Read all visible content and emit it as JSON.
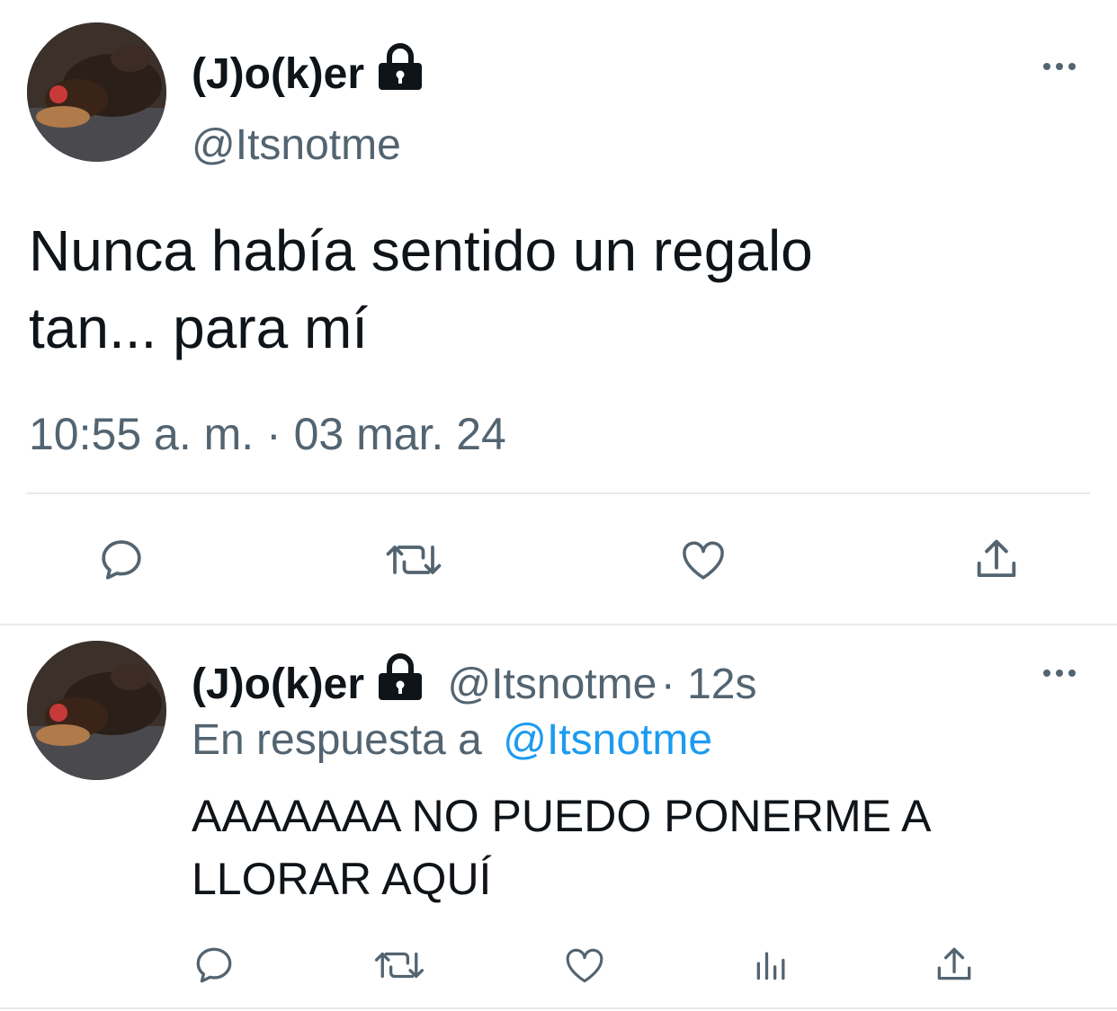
{
  "main_tweet": {
    "display_name": "(J)o(k)er",
    "handle": "@Itsnotme",
    "text_line1": "Nunca había sentido un regalo",
    "text_line2": "tan... para mí",
    "timestamp": "10:55 a. m. · 03 mar. 24",
    "avatar": "dog-avatar",
    "actions": [
      "reply-icon",
      "retweet-icon",
      "like-icon",
      "share-icon"
    ]
  },
  "reply_tweet": {
    "display_name": "(J)o(k)er",
    "handle": "@Itsnotme",
    "time_ago": "· 12s",
    "in_reply_prefix": "En respuesta a",
    "in_reply_handle": "@Itsnotme",
    "text_line1": "AAAAAAA NO PUEDO PONERME A",
    "text_line2": "LLORAR AQUÍ",
    "avatar": "dog-avatar",
    "actions": [
      "reply-icon",
      "retweet-icon",
      "like-icon",
      "analytics-icon",
      "share-icon"
    ]
  },
  "colors": {
    "text": "#0f1419",
    "secondary": "#536471",
    "link": "#1d9bf0",
    "divider": "#e6e9ec"
  }
}
